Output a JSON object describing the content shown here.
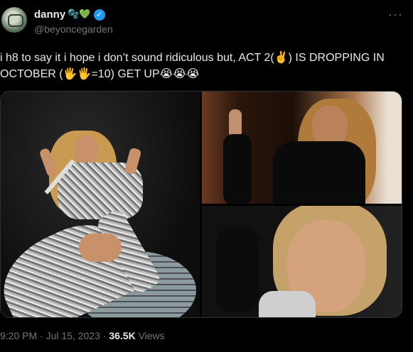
{
  "user": {
    "display_name": "danny",
    "name_emojis": "🫧💚",
    "handle": "@beyoncegarden",
    "verified": true,
    "verified_color": "#1d9bf0"
  },
  "more_icon": "more-horizontal-icon",
  "tweet": {
    "text": "i h8 to say it i hope i don’t sound ridiculous but, ACT 2(✌️) IS DROPPING IN OCTOBER (🖐️🖐️=10) GET UP😭😭😭"
  },
  "media": {
    "images": [
      "performer-on-disco-ball-photo",
      "peace-sign-black-outfit-photo",
      "peace-sign-selfie-photo"
    ]
  },
  "meta": {
    "time": "9:20 PM",
    "separator": "·",
    "date": "Jul 15, 2023",
    "views_count": "36.5K",
    "views_label": "Views"
  },
  "colors": {
    "background": "#000000",
    "text": "#e7e9ea",
    "secondary_text": "#71767b"
  }
}
